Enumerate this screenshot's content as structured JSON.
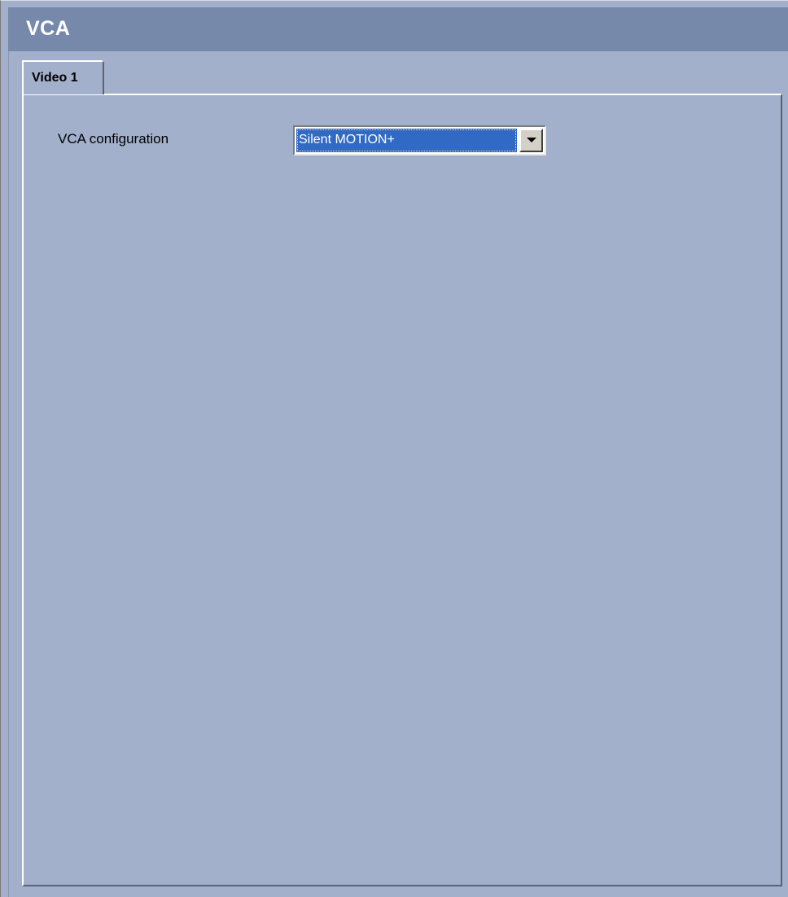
{
  "header": {
    "title": "VCA"
  },
  "tabs": [
    {
      "label": "Video 1",
      "active": true
    }
  ],
  "form": {
    "vca_configuration": {
      "label": "VCA configuration",
      "selected": "Silent MOTION+"
    }
  },
  "colors": {
    "background": "#a3b0cb",
    "title_bar": "#7689ab",
    "selection": "#316ac5"
  },
  "icons": {
    "dropdown": "chevron-down-icon"
  }
}
